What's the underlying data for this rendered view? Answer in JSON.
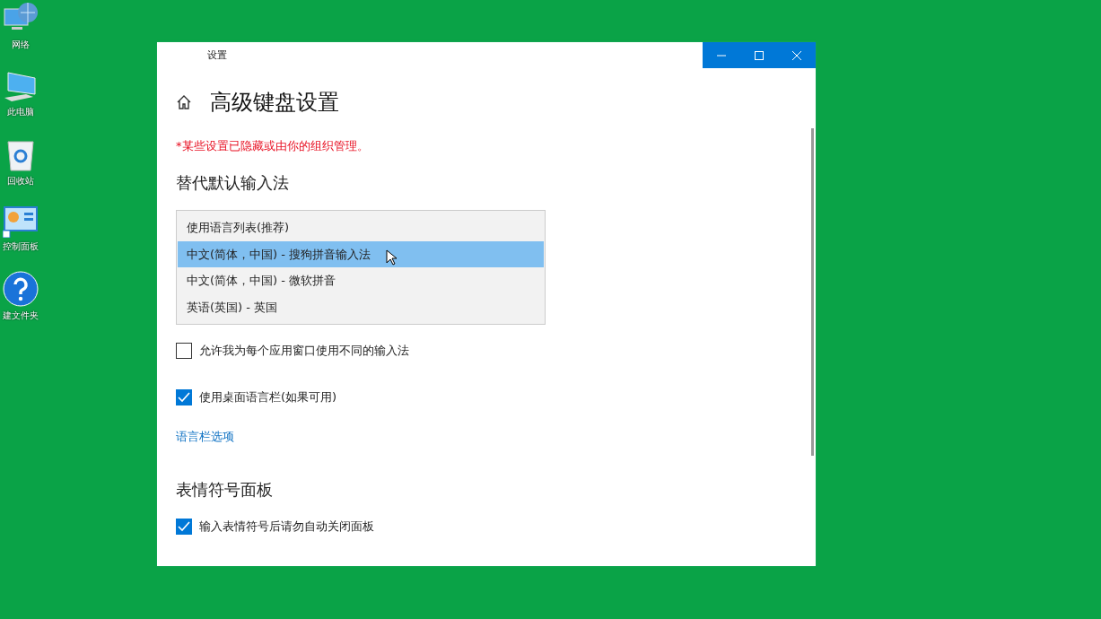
{
  "desktop_icons": [
    {
      "label": "网络",
      "kind": "network"
    },
    {
      "label": "此电脑",
      "kind": "computer"
    },
    {
      "label": "回收站",
      "kind": "recycle"
    },
    {
      "label": "控制面板",
      "kind": "control"
    },
    {
      "label": "建文件夹",
      "kind": "help"
    }
  ],
  "window": {
    "title": "设置",
    "page_title": "高级键盘设置",
    "notice": "*某些设置已隐藏或由你的组织管理。",
    "section": "替代默认输入法",
    "dropdown": {
      "options": [
        {
          "label": "使用语言列表(推荐)",
          "selected": false
        },
        {
          "label": "中文(简体，中国) - 搜狗拼音输入法",
          "selected": true
        },
        {
          "label": "中文(简体，中国) - 微软拼音",
          "selected": false
        },
        {
          "label": "英语(英国) - 英国",
          "selected": false
        }
      ]
    },
    "options": [
      {
        "label": "允许我为每个应用窗口使用不同的输入法",
        "checked": false
      },
      {
        "label": "使用桌面语言栏(如果可用)",
        "checked": true
      }
    ],
    "link": "语言栏选项",
    "section2": "表情符号面板",
    "options2": [
      {
        "label": "输入表情符号后请勿自动关闭面板",
        "checked": true
      }
    ]
  }
}
